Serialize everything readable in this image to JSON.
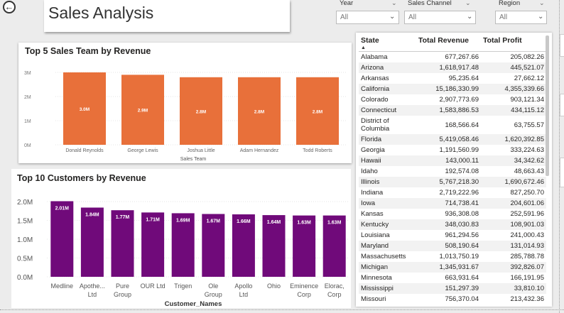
{
  "title": "Sales Analysis",
  "slicers": [
    {
      "label": "Year",
      "value": "All"
    },
    {
      "label": "Sales Channel",
      "value": "All"
    },
    {
      "label": "Region",
      "value": "All"
    }
  ],
  "sales_team_chart": {
    "title": "Top 5 Sales Team by Revenue",
    "bar_color": "#e8703a",
    "y_ticks": [
      "0M",
      "1M",
      "2M",
      "3M"
    ],
    "data_labels": [
      "3.0M",
      "2.9M",
      "2.8M",
      "2.8M",
      "2.8M"
    ]
  },
  "customers_chart": {
    "title": "Top 10 Customers by Revenue",
    "bar_color": "#700a7a",
    "y_ticks": [
      "0.0M",
      "0.5M",
      "1.0M",
      "1.5M",
      "2.0M"
    ],
    "data_labels": [
      "2.01M",
      "1.84M",
      "1.77M",
      "1.71M",
      "1.69M",
      "1.67M",
      "1.66M",
      "1.64M",
      "1.63M",
      "1.63M"
    ]
  },
  "chart_data": [
    {
      "type": "bar",
      "title": "Top 5 Sales Team by Revenue",
      "categories": [
        "Donald Reynolds",
        "George Lewis",
        "Joshua Little",
        "Adam Hernandez",
        "Todd Roberts"
      ],
      "values": [
        3.0,
        2.9,
        2.8,
        2.8,
        2.8
      ],
      "xlabel": "Sales Team",
      "ylabel": "",
      "ylim": [
        0,
        3
      ],
      "unit": "M"
    },
    {
      "type": "bar",
      "title": "Top 10 Customers by Revenue",
      "categories": [
        "Medline",
        "Apotheca, Ltd",
        "Pure Group",
        "OUR Ltd",
        "Trigen",
        "Ole Group",
        "Apollo Ltd",
        "Ohio",
        "Eminence Corp",
        "Elorac, Corp"
      ],
      "category_lines": [
        [
          "Medline"
        ],
        [
          "Apothe...",
          "Ltd"
        ],
        [
          "Pure",
          "Group"
        ],
        [
          "OUR Ltd"
        ],
        [
          "Trigen"
        ],
        [
          "Ole",
          "Group"
        ],
        [
          "Apollo",
          "Ltd"
        ],
        [
          "Ohio"
        ],
        [
          "Eminence",
          "Corp"
        ],
        [
          "Elorac,",
          "Corp"
        ]
      ],
      "values": [
        2.01,
        1.84,
        1.77,
        1.71,
        1.69,
        1.67,
        1.66,
        1.64,
        1.63,
        1.63
      ],
      "xlabel": "Customer_Names",
      "ylabel": "",
      "ylim": [
        0,
        2.0
      ],
      "unit": "M"
    }
  ],
  "table": {
    "headers": [
      "State",
      "Total Revenue",
      "Total Profit"
    ],
    "rows": [
      [
        "Alabama",
        "677,267.66",
        "205,082.26"
      ],
      [
        "Arizona",
        "1,618,917.48",
        "445,521.07"
      ],
      [
        "Arkansas",
        "95,235.64",
        "27,662.12"
      ],
      [
        "California",
        "15,186,330.99",
        "4,355,339.66"
      ],
      [
        "Colorado",
        "2,907,773.69",
        "903,121.34"
      ],
      [
        "Connecticut",
        "1,583,886.53",
        "434,115.12"
      ],
      [
        "District of Columbia",
        "168,566.64",
        "63,755.57"
      ],
      [
        "Florida",
        "5,419,058.46",
        "1,620,392.85"
      ],
      [
        "Georgia",
        "1,191,560.99",
        "333,224.63"
      ],
      [
        "Hawaii",
        "143,000.11",
        "34,342.62"
      ],
      [
        "Idaho",
        "192,574.08",
        "48,663.43"
      ],
      [
        "Illinois",
        "5,767,218.30",
        "1,690,672.46"
      ],
      [
        "Indiana",
        "2,719,222.96",
        "827,250.70"
      ],
      [
        "Iowa",
        "714,738.41",
        "204,601.06"
      ],
      [
        "Kansas",
        "936,308.08",
        "252,591.96"
      ],
      [
        "Kentucky",
        "348,030.83",
        "108,901.03"
      ],
      [
        "Louisiana",
        "961,294.56",
        "241,000.43"
      ],
      [
        "Maryland",
        "508,190.64",
        "131,014.93"
      ],
      [
        "Massachusetts",
        "1,013,750.19",
        "285,788.78"
      ],
      [
        "Michigan",
        "1,345,931.67",
        "392,826.07"
      ],
      [
        "Minnesota",
        "663,931.64",
        "166,191.95"
      ],
      [
        "Mississippi",
        "151,297.39",
        "33,810.10"
      ],
      [
        "Missouri",
        "756,370.04",
        "213,432.36"
      ]
    ]
  }
}
